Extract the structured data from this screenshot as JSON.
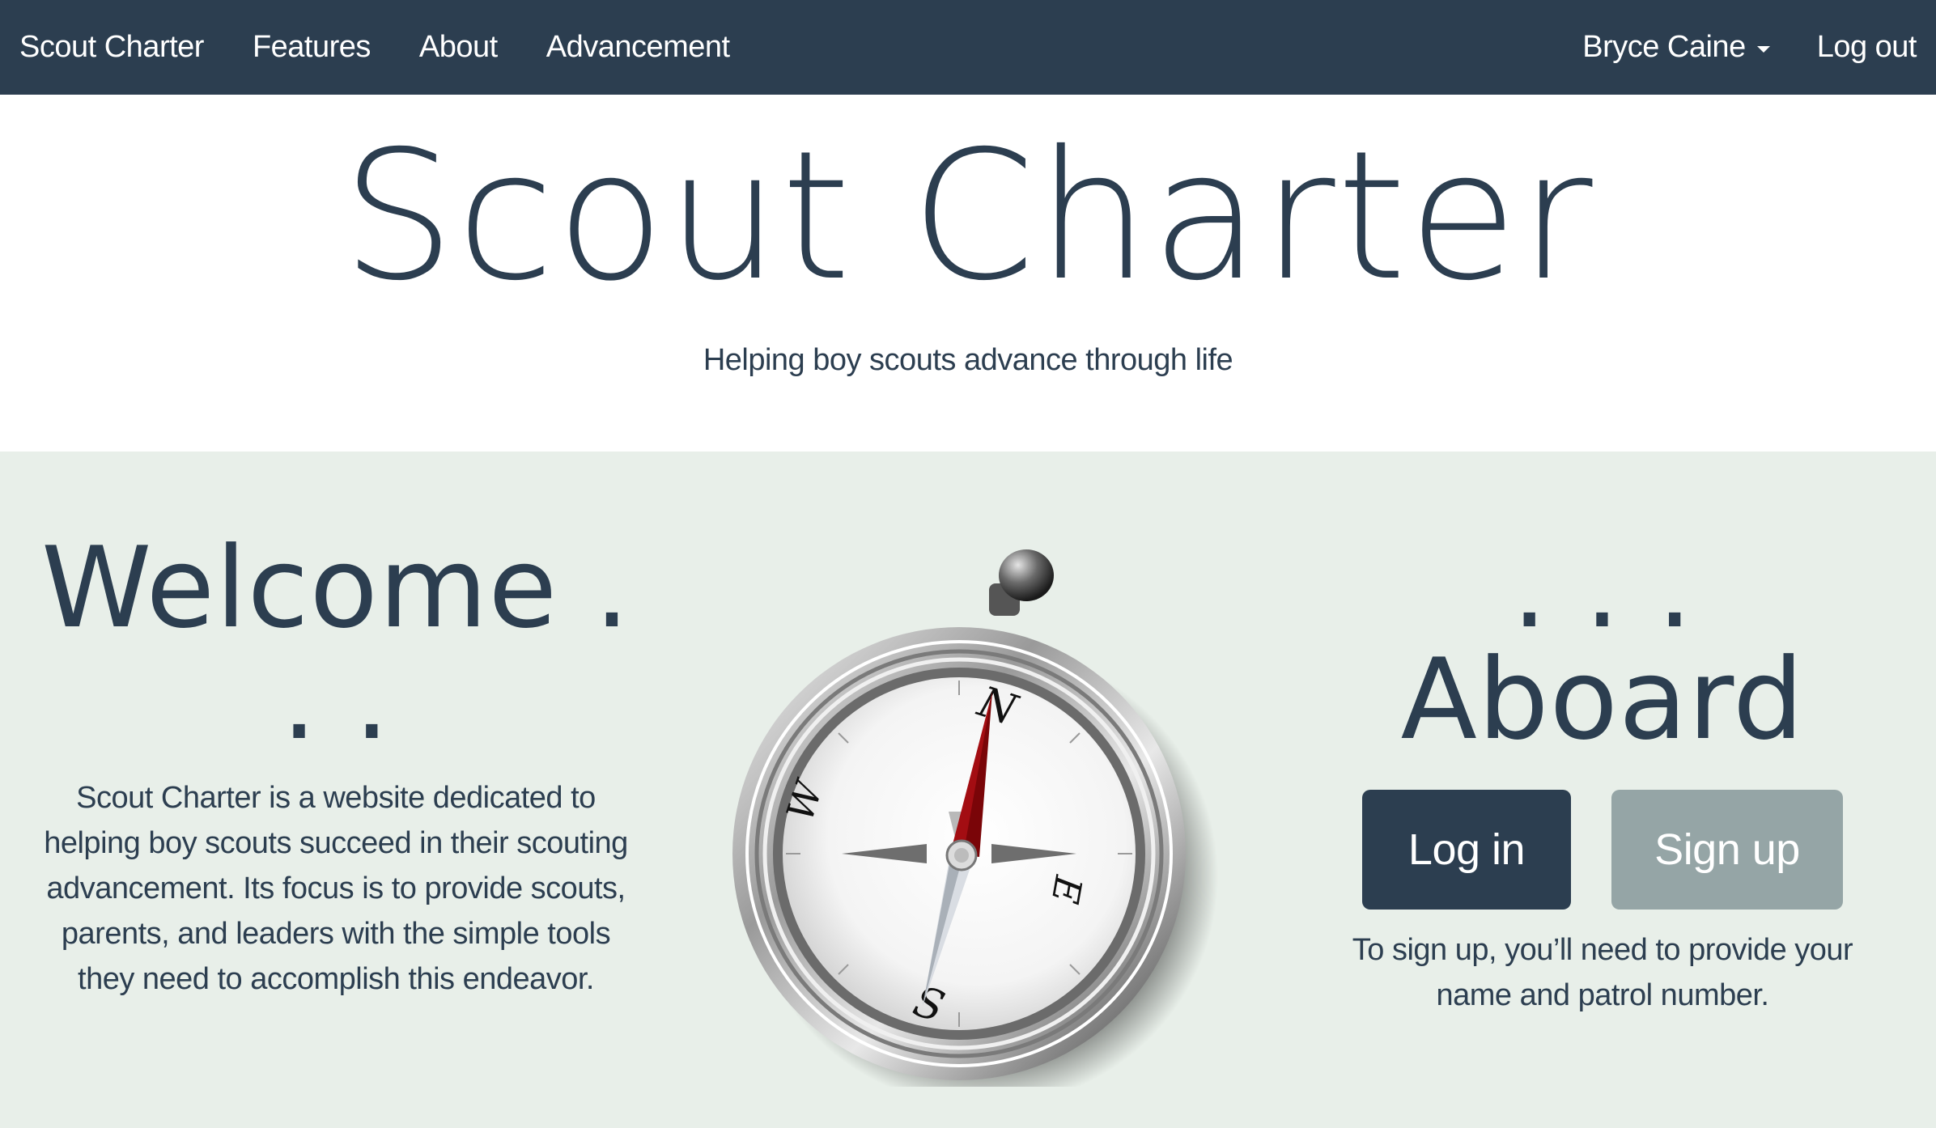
{
  "navbar": {
    "brand": "Scout Charter",
    "links": [
      "Features",
      "About",
      "Advancement"
    ],
    "user_menu": "Bryce Caine",
    "logout": "Log out"
  },
  "hero": {
    "title": "Scout Charter",
    "tagline": "Helping boy scouts advance through life"
  },
  "welcome": {
    "heading": "Welcome . . .",
    "description": "Scout Charter is a website dedicated to helping boy scouts succeed in their scouting advancement. Its focus is to provide scouts, parents, and leaders with the simple tools they need to accomplish this endeavor."
  },
  "compass": {
    "north": "N",
    "east": "E",
    "south": "S",
    "west": "W"
  },
  "aboard": {
    "heading": ". . . Aboard",
    "login_label": "Log in",
    "signup_label": "Sign up",
    "signup_note": "To sign up, you’ll need to provide your name and patrol number."
  },
  "colors": {
    "primary": "#2c3e50",
    "secondary": "#95a5a6",
    "section_bg": "#e8efe9",
    "needle_red": "#a30d12"
  }
}
